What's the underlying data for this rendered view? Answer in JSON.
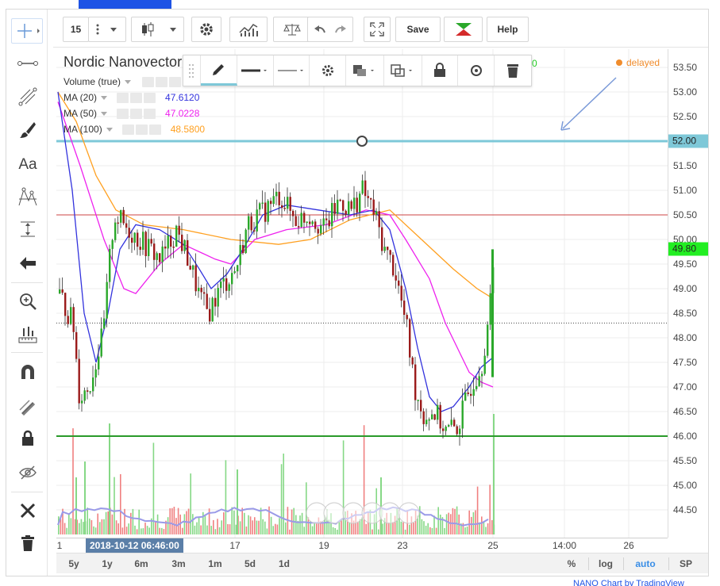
{
  "header": {
    "interval_value": "15",
    "save_label": "Save",
    "help_label": "Help"
  },
  "left_tools": [
    "crosshair-icon",
    "line-segment-icon",
    "fibonacci-icon",
    "brush-icon",
    "text-tool-icon",
    "pattern-icon",
    "measure-icon",
    "arrow-icon",
    "zoom-icon",
    "ruler-icon",
    "magnet-icon",
    "lock-drawing-icon",
    "lock-icon",
    "hide-icon",
    "remove-tools-icon",
    "trash-icon"
  ],
  "left_text_tool": "Aa",
  "chart": {
    "title": "Nordic Nanovector",
    "delayed_label": "delayed",
    "partial_value": "0",
    "studies": [
      {
        "name": "Volume (true)",
        "value": "",
        "color": "#888888"
      },
      {
        "name": "MA (20)",
        "value": "47.6120",
        "color": "#3333dd"
      },
      {
        "name": "MA (50)",
        "value": "47.0228",
        "color": "#ee22ee"
      },
      {
        "name": "MA (100)",
        "value": "48.5800",
        "color": "#ffa020"
      }
    ],
    "y_ticks": [
      "53.50",
      "53.00",
      "52.50",
      "52.00",
      "51.50",
      "51.00",
      "50.50",
      "50.00",
      "49.50",
      "49.00",
      "48.50",
      "48.00",
      "47.50",
      "47.00",
      "46.50",
      "46.00",
      "45.50",
      "45.00",
      "44.50"
    ],
    "y_ticks_visible": [
      "53.50",
      "53.00",
      "52.50",
      "51.50",
      "51.00",
      "50.50",
      "50.00",
      "49.50",
      "49.00",
      "48.50",
      "48.00",
      "47.50",
      "47.00",
      "46.50",
      "46.00",
      "45.50",
      "45.00",
      "44.50"
    ],
    "tag_52": "52.00",
    "last_price": "49.80",
    "hline_52": 52.0,
    "hline_505": 50.5,
    "hline_46": 46.0,
    "current_price": 48.3,
    "x_ticks": [
      "1",
      "17",
      "19",
      "23",
      "25",
      "14:00",
      "26"
    ],
    "crosshair_time": "2018-10-12 06:46:00",
    "colors": {
      "up": "#2aa82a",
      "down": "#9b1b1b",
      "hline_cyan": "#7ec8d8",
      "hline_red": "#cc4444",
      "hline_green": "#2a9a2a",
      "last_tag": "#22ee22"
    }
  },
  "range_buttons": [
    "5y",
    "1y",
    "6m",
    "3m",
    "1m",
    "5d",
    "1d"
  ],
  "scale_buttons": [
    "%",
    "log",
    "auto",
    "SP"
  ],
  "footer_text": "NANO Chart by TradingView"
}
